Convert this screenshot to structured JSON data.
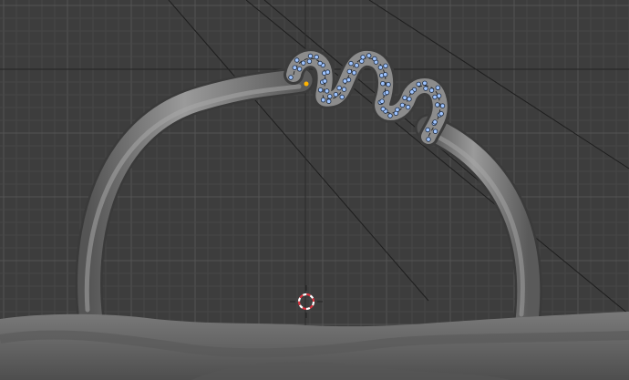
{
  "app": "3D viewport",
  "scene": {
    "view_mode": "solid",
    "grid": true,
    "objects": [
      "ring-tube",
      "helix-curve",
      "ground-surface"
    ],
    "edit_mode_points": true,
    "cursor": "3d-cursor-icon"
  },
  "colors": {
    "background": "#3d3d3d",
    "grid_minor": "#474747",
    "grid_major": "#555555",
    "mesh": "#8a8a8a",
    "mesh_shadow": "#4f4f4f",
    "ground": "#6c6c6c",
    "vertex": "#9fc4ff",
    "active_vertex": "#ffb400",
    "cursor_red": "#d9333f",
    "cursor_white": "#ffffff"
  }
}
